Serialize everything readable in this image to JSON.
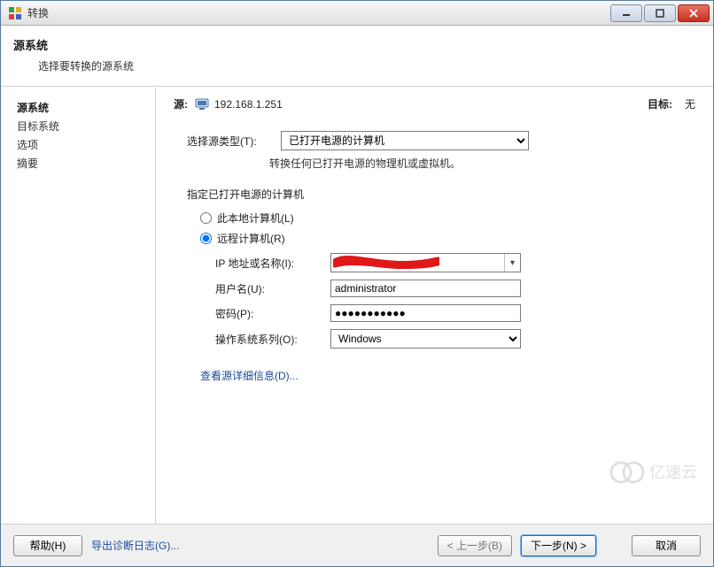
{
  "title": "转换",
  "header": {
    "title": "源系统",
    "subtitle": "选择要转换的源系统"
  },
  "sidebar": {
    "items": [
      {
        "label": "源系统",
        "active": true
      },
      {
        "label": "目标系统",
        "active": false
      },
      {
        "label": "选项",
        "active": false
      },
      {
        "label": "摘要",
        "active": false
      }
    ]
  },
  "content": {
    "source_label": "源:",
    "source_value": "192.168.1.251",
    "target_label": "目标:",
    "target_value": "无",
    "source_type_label": "选择源类型(T):",
    "source_type_value": "已打开电源的计算机",
    "source_type_hint": "转换任何已打开电源的物理机或虚拟机。",
    "fieldset_title": "指定已打开电源的计算机",
    "radio_local": "此本地计算机(L)",
    "radio_remote": "远程计算机(R)",
    "selected_radio": "remote",
    "ip_label": "IP 地址或名称(I):",
    "ip_value": "",
    "username_label": "用户名(U):",
    "username_value": "administrator",
    "password_label": "密码(P):",
    "password_value": "●●●●●●●●●●●",
    "os_label": "操作系统系列(O):",
    "os_value": "Windows",
    "details_link": "查看源详细信息(D)..."
  },
  "footer": {
    "help": "帮助(H)",
    "export_log": "导出诊断日志(G)...",
    "back": "< 上一步(B)",
    "next": "下一步(N) >",
    "cancel": "取消"
  },
  "watermark": "亿速云"
}
